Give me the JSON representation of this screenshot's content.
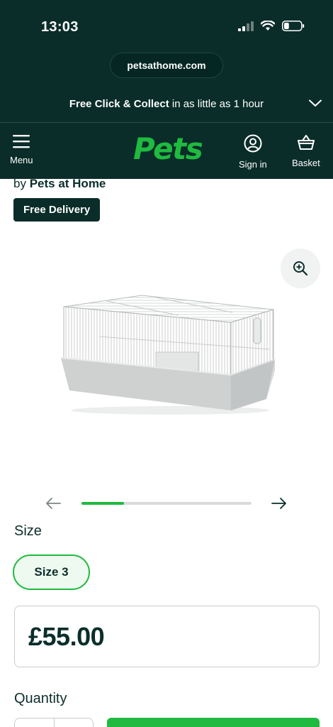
{
  "status_bar": {
    "time": "13:03",
    "battery_level": 0.3
  },
  "browser": {
    "url": "petsathome.com"
  },
  "promo": {
    "bold_text": "Free Click & Collect",
    "rest_text": " in as little as 1 hour"
  },
  "nav": {
    "menu_label": "Menu",
    "logo_text": "Pets",
    "sign_in_label": "Sign in",
    "basket_label": "Basket"
  },
  "product": {
    "by_prefix": "by ",
    "brand": "Pets at Home",
    "delivery_badge": "Free Delivery",
    "carousel_progress": 0.25
  },
  "size": {
    "label": "Size",
    "selected": "Size 3"
  },
  "price": "£55.00",
  "quantity": {
    "label": "Quantity"
  },
  "colors": {
    "dark": "#0a2d29",
    "brand_green": "#1fba3f",
    "text": "#0b2e2a",
    "chip_bg": "#eef9ef"
  },
  "icons": [
    "signal-icon",
    "wifi-icon",
    "battery-icon",
    "chevron-down-icon",
    "hamburger-icon",
    "user-icon",
    "basket-icon",
    "zoom-in-icon",
    "arrow-left-icon",
    "arrow-right-icon"
  ]
}
